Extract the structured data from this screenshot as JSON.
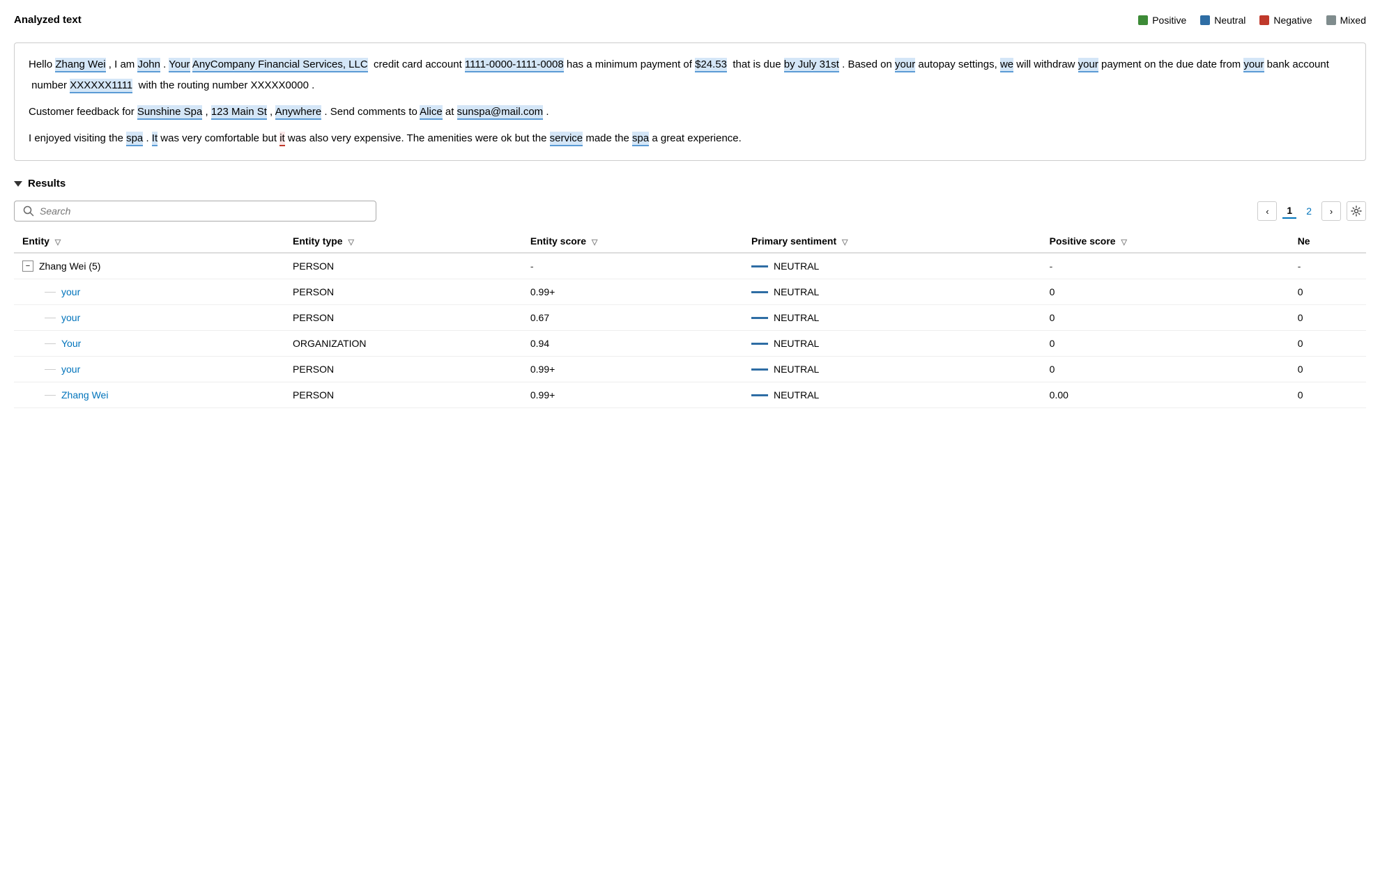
{
  "header": {
    "analyzed_text_title": "Analyzed text",
    "results_title": "Results"
  },
  "legend": {
    "items": [
      {
        "label": "Positive",
        "color": "#3d8b37"
      },
      {
        "label": "Neutral",
        "color": "#2e6da4"
      },
      {
        "label": "Negative",
        "color": "#c0392b"
      },
      {
        "label": "Mixed",
        "color": "#7f8c8d"
      }
    ]
  },
  "text_content": {
    "paragraph1": "Hello Zhang Wei , I am John . Your AnyCompany Financial Services, LLC credit card account 1111-0000-1111-0008 has a minimum payment of $24.53 that is due by July 31st . Based on your autopay settings, we will withdraw your payment on the due date from your bank account number XXXXXX1111 with the routing number XXXXX0000 .",
    "paragraph2": "Customer feedback for Sunshine Spa , 123 Main St , Anywhere . Send comments to Alice at sunspa@mail.com .",
    "paragraph3": "I enjoyed visiting the spa . It was very comfortable but it was also very expensive. The amenities were ok but the service made the spa a great experience."
  },
  "search": {
    "placeholder": "Search"
  },
  "pagination": {
    "current_page": "1",
    "next_page": "2"
  },
  "table": {
    "headers": [
      {
        "label": "Entity"
      },
      {
        "label": "Entity type"
      },
      {
        "label": "Entity score"
      },
      {
        "label": "Primary sentiment"
      },
      {
        "label": "Positive score"
      },
      {
        "label": "Ne"
      }
    ],
    "rows": [
      {
        "type": "parent",
        "entity": "Zhang Wei (5)",
        "entity_type": "PERSON",
        "entity_score": "-",
        "primary_sentiment": "NEUTRAL",
        "positive_score": "-",
        "ne_score": "-"
      },
      {
        "type": "child",
        "entity": "your",
        "entity_type": "PERSON",
        "entity_score": "0.99+",
        "primary_sentiment": "NEUTRAL",
        "positive_score": "0",
        "ne_score": "0"
      },
      {
        "type": "child",
        "entity": "your",
        "entity_type": "PERSON",
        "entity_score": "0.67",
        "primary_sentiment": "NEUTRAL",
        "positive_score": "0",
        "ne_score": "0"
      },
      {
        "type": "child",
        "entity": "Your",
        "entity_type": "ORGANIZATION",
        "entity_score": "0.94",
        "primary_sentiment": "NEUTRAL",
        "positive_score": "0",
        "ne_score": "0"
      },
      {
        "type": "child",
        "entity": "your",
        "entity_type": "PERSON",
        "entity_score": "0.99+",
        "primary_sentiment": "NEUTRAL",
        "positive_score": "0",
        "ne_score": "0"
      },
      {
        "type": "child",
        "entity": "Zhang Wei",
        "entity_type": "PERSON",
        "entity_score": "0.99+",
        "primary_sentiment": "NEUTRAL",
        "positive_score": "0.00",
        "ne_score": "0"
      }
    ]
  }
}
